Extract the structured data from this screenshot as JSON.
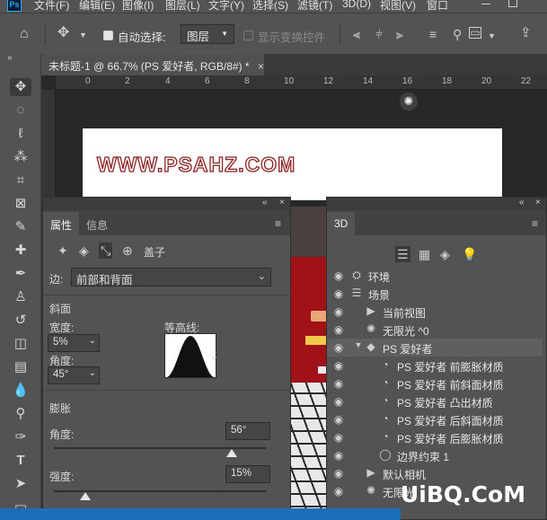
{
  "menu": {
    "app_icon": "Ps",
    "items": [
      "文件(F)",
      "编辑(E)",
      "图像(I)",
      "图层(L)",
      "文字(Y)",
      "选择(S)",
      "滤镜(T)",
      "3D(D)",
      "视图(V)",
      "窗口"
    ]
  },
  "options": {
    "auto_select_label": "自动选择:",
    "auto_select_value": "图层",
    "show_transform_label": "显示变换控件"
  },
  "document": {
    "tab_title": "未标题-1 @ 66.7% (PS 爱好者, RGB/8#) *",
    "canvas_text": "WWW.PSAHZ.COM",
    "ruler_numbers": [
      "0",
      "2",
      "4",
      "6",
      "8",
      "10",
      "12",
      "14",
      "16",
      "18",
      "20",
      "22"
    ]
  },
  "properties": {
    "tabs": [
      "属性",
      "信息"
    ],
    "section_cap": "盖子",
    "side_label": "边:",
    "side_value": "前部和背面",
    "bevel_header": "斜面",
    "width_label": "宽度:",
    "width_value": "5%",
    "angle_label": "角度:",
    "angle_value": "45°",
    "contour_label": "等高线:",
    "inflate_header": "膨胀",
    "inflate_angle_label": "角度:",
    "inflate_angle_value": "56°",
    "inflate_angle_fraction": 0.84,
    "strength_label": "强度:",
    "strength_value": "15%",
    "strength_fraction": 0.15
  },
  "panel3d": {
    "tab": "3D",
    "rows": [
      {
        "icon": "environment-icon",
        "label": "环境",
        "indent": 0
      },
      {
        "icon": "scene-icon",
        "label": "场景",
        "indent": 0
      },
      {
        "icon": "camera-icon",
        "label": "当前视图",
        "indent": 1
      },
      {
        "icon": "light-icon",
        "label": "无限光 ^0",
        "indent": 1
      },
      {
        "icon": "mesh-icon",
        "label": "PS 爱好者",
        "indent": 1
      },
      {
        "icon": "material-icon",
        "label": "PS 爱好者 前膨胀材质",
        "indent": 2
      },
      {
        "icon": "material-icon",
        "label": "PS 爱好者 前斜面材质",
        "indent": 2
      },
      {
        "icon": "material-icon",
        "label": "PS 爱好者 凸出材质",
        "indent": 2
      },
      {
        "icon": "material-icon",
        "label": "PS 爱好者 后斜面材质",
        "indent": 2
      },
      {
        "icon": "material-icon",
        "label": "PS 爱好者 后膨胀材质",
        "indent": 2
      },
      {
        "icon": "constraint-icon",
        "label": "边界约束 1",
        "indent": 2
      },
      {
        "icon": "camera-icon",
        "label": "默认相机",
        "indent": 1
      },
      {
        "icon": "light-icon",
        "label": "无限光",
        "indent": 1
      }
    ]
  },
  "watermark": "UiBQ.CoM",
  "colors": {
    "panel": "#535353",
    "dark": "#282828",
    "accent": "#31a8ff",
    "doc_red": "#a01218"
  }
}
